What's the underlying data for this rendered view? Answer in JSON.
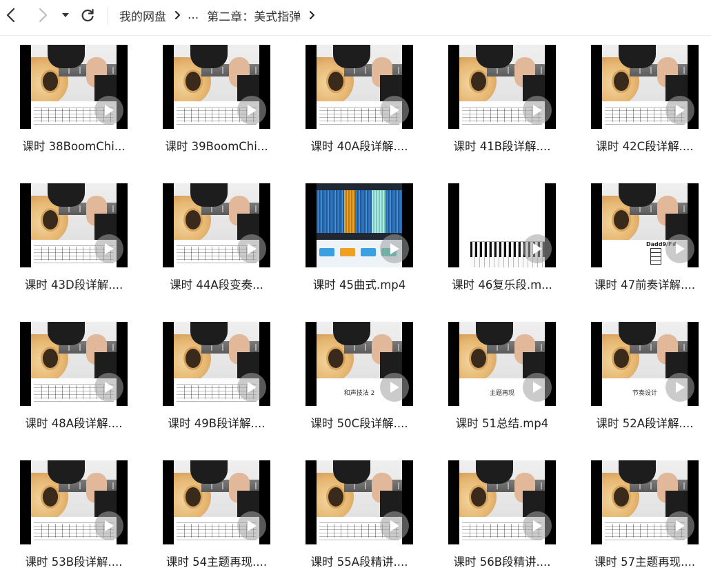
{
  "toolbar": {
    "back_icon": "chevron-left-icon",
    "forward_icon": "chevron-right-icon",
    "history_icon": "caret-down-icon",
    "refresh_icon": "refresh-icon",
    "breadcrumb": [
      "我的网盘",
      "...",
      "第二章：美式指弹"
    ]
  },
  "files": [
    {
      "title": "课时 38BoomChi...",
      "thumb": "guitar-tab"
    },
    {
      "title": "课时 39BoomChi...",
      "thumb": "guitar-sheet"
    },
    {
      "title": "课时 40A段详解....",
      "thumb": "guitar-sheet"
    },
    {
      "title": "课时 41B段详解....",
      "thumb": "guitar-sheet"
    },
    {
      "title": "课时 42C段详解....",
      "thumb": "guitar-sheet"
    },
    {
      "title": "课时 43D段详解....",
      "thumb": "guitar-sheet"
    },
    {
      "title": "课时 44A段变奏...",
      "thumb": "guitar-sheet"
    },
    {
      "title": "课时 45曲式.mp4",
      "thumb": "mixer"
    },
    {
      "title": "课时 46复乐段.m...",
      "thumb": "piano"
    },
    {
      "title": "课时 47前奏详解....",
      "thumb": "chord",
      "thumb_text": "Dadd9/F#"
    },
    {
      "title": "课时 48A段详解....",
      "thumb": "guitar-sheet"
    },
    {
      "title": "课时 49B段详解....",
      "thumb": "guitar-sheet"
    },
    {
      "title": "课时 50C段详解....",
      "thumb": "guitar-label",
      "thumb_text": "和声技法 2"
    },
    {
      "title": "课时 51总结.mp4",
      "thumb": "guitar-label",
      "thumb_text": "主题再现"
    },
    {
      "title": "课时 52A段详解....",
      "thumb": "guitar-label",
      "thumb_text": "节奏设计"
    },
    {
      "title": "课时 53B段详解....",
      "thumb": "guitar-sheet"
    },
    {
      "title": "课时 54主题再现....",
      "thumb": "guitar-sheet"
    },
    {
      "title": "课时 55A段精讲....",
      "thumb": "guitar-sheet"
    },
    {
      "title": "课时 56B段精讲....",
      "thumb": "guitar-sheet"
    },
    {
      "title": "课时 57主题再现....",
      "thumb": "guitar-sheet"
    }
  ],
  "colors": {
    "play_overlay": "#a0a0a0",
    "text": "#222222",
    "divider": "#ececec"
  }
}
